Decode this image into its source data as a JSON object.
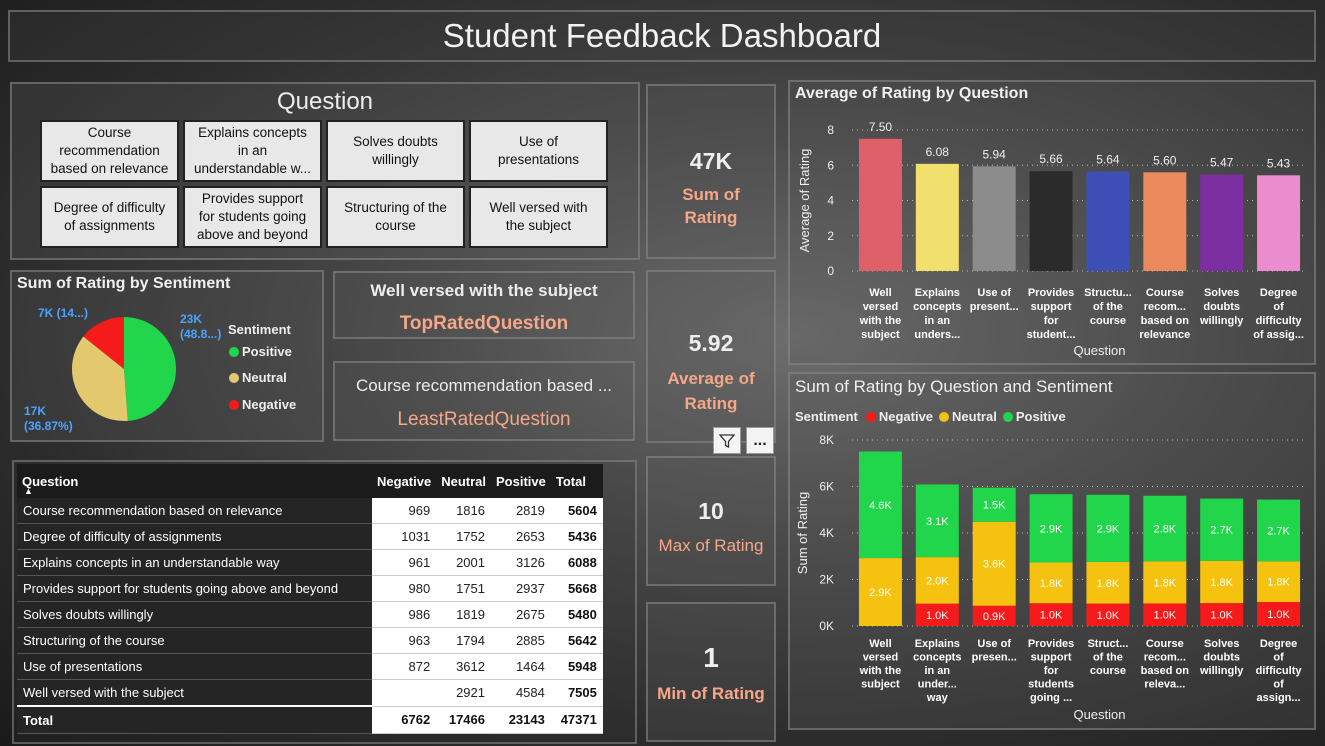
{
  "title": "Student Feedback Dashboard",
  "slicer": {
    "title": "Question",
    "items": [
      "Course recommendation based on relevance",
      "Explains concepts in an understandable w...",
      "Solves doubts willingly",
      "Use of presentations",
      "Degree of difficulty of assignments",
      "Provides support for students going above and beyond",
      "Structuring of the course",
      "Well versed with the subject"
    ]
  },
  "pie": {
    "title": "Sum of Rating by Sentiment",
    "label_positive": "23K (48.8...)",
    "label_neutral": "17K (36.87%)",
    "label_negative": "7K (14...)",
    "legend_title": "Sentiment",
    "legend": [
      "Positive",
      "Neutral",
      "Negative"
    ],
    "values": {
      "positive": 23143,
      "neutral": 17466,
      "negative": 6762
    },
    "colors": {
      "positive": "#21d64a",
      "neutral": "#e3c86d",
      "negative": "#f51b1b"
    }
  },
  "cards": {
    "top_value": "Well versed with the subject",
    "top_label": "TopRatedQuestion",
    "least_value": "Course recommendation based ...",
    "least_label": "LeastRatedQuestion",
    "sum_value": "47K",
    "sum_label_1": "Sum of",
    "sum_label_2": "Rating",
    "avg_value": "5.92",
    "avg_label_1": "Average of",
    "avg_label_2": "Rating",
    "max_value": "10",
    "max_label": "Max of Rating",
    "min_value": "1",
    "min_label": "Min of Rating"
  },
  "toolbar": {
    "filter_icon": "filter-icon",
    "more_label": "..."
  },
  "table": {
    "headers": [
      "Question",
      "Negative",
      "Neutral",
      "Positive",
      "Total"
    ],
    "rows": [
      [
        "Course recommendation based on relevance",
        "969",
        "1816",
        "2819",
        "5604"
      ],
      [
        "Degree of difficulty of assignments",
        "1031",
        "1752",
        "2653",
        "5436"
      ],
      [
        "Explains concepts in an understandable way",
        "961",
        "2001",
        "3126",
        "6088"
      ],
      [
        "Provides support for students going above and beyond",
        "980",
        "1751",
        "2937",
        "5668"
      ],
      [
        "Solves doubts willingly",
        "986",
        "1819",
        "2675",
        "5480"
      ],
      [
        "Structuring of the course",
        "963",
        "1794",
        "2885",
        "5642"
      ],
      [
        "Use of presentations",
        "872",
        "3612",
        "1464",
        "5948"
      ],
      [
        "Well versed with the subject",
        "",
        "2921",
        "4584",
        "7505"
      ]
    ],
    "total": [
      "Total",
      "6762",
      "17466",
      "23143",
      "47371"
    ]
  },
  "chart_data": [
    {
      "type": "bar",
      "title": "Average of Rating by Question",
      "xlabel": "Question",
      "ylabel": "Average of Rating",
      "ylim": [
        0,
        8
      ],
      "yticks": [
        "0",
        "2",
        "4",
        "6",
        "8"
      ],
      "categories": [
        [
          "Well",
          "versed",
          "with the",
          "subject"
        ],
        [
          "Explains",
          "concepts",
          "in an",
          "unders..."
        ],
        [
          "Use of",
          "present..."
        ],
        [
          "Provides",
          "support",
          "for",
          "student..."
        ],
        [
          "Structu...",
          "of the",
          "course"
        ],
        [
          "Course",
          "recom...",
          "based on",
          "relevance"
        ],
        [
          "Solves",
          "doubts",
          "willingly"
        ],
        [
          "Degree",
          "of",
          "difficulty",
          "of assig..."
        ]
      ],
      "values": [
        7.5,
        6.08,
        5.94,
        5.66,
        5.64,
        5.6,
        5.47,
        5.43
      ],
      "labels": [
        "7.50",
        "6.08",
        "5.94",
        "5.66",
        "5.64",
        "5.60",
        "5.47",
        "5.43"
      ],
      "colors": [
        "#e0606a",
        "#f2e06e",
        "#8c8c8c",
        "#2b2b2b",
        "#3f4fb8",
        "#eb8a5c",
        "#7b2fa0",
        "#ea8ccd"
      ],
      "grid": true
    },
    {
      "type": "bar",
      "stacked": true,
      "title": "Sum of Rating by Question and Sentiment",
      "xlabel": "Question",
      "ylabel": "Sum of Rating",
      "ylim": [
        0,
        8000
      ],
      "yticks": [
        "0K",
        "2K",
        "4K",
        "6K",
        "8K"
      ],
      "legend_title": "Sentiment",
      "legend_position": "top-left",
      "categories": [
        [
          "Well",
          "versed",
          "with the",
          "subject"
        ],
        [
          "Explains",
          "concepts",
          "in an",
          "under...",
          "way"
        ],
        [
          "Use of",
          "presen..."
        ],
        [
          "Provides",
          "support",
          "for",
          "students",
          "going ..."
        ],
        [
          "Struct...",
          "of the",
          "course"
        ],
        [
          "Course",
          "recom...",
          "based on",
          "releva..."
        ],
        [
          "Solves",
          "doubts",
          "willingly"
        ],
        [
          "Degree",
          "of",
          "difficulty",
          "of",
          "assign..."
        ]
      ],
      "series": [
        {
          "name": "Negative",
          "color": "#f51b1b",
          "values": [
            0,
            961,
            872,
            980,
            963,
            969,
            986,
            1031
          ],
          "labels": [
            "",
            "1.0K",
            "0.9K",
            "1.0K",
            "1.0K",
            "1.0K",
            "1.0K",
            "1.0K"
          ]
        },
        {
          "name": "Neutral",
          "color": "#f4c20f",
          "values": [
            2921,
            2001,
            3612,
            1751,
            1794,
            1816,
            1819,
            1752
          ],
          "labels": [
            "2.9K",
            "2.0K",
            "3.6K",
            "1.8K",
            "1.8K",
            "1.8K",
            "1.8K",
            "1.8K"
          ]
        },
        {
          "name": "Positive",
          "color": "#21d64a",
          "values": [
            4584,
            3126,
            1464,
            2937,
            2885,
            2819,
            2675,
            2653
          ],
          "labels": [
            "4.6K",
            "3.1K",
            "1.5K",
            "2.9K",
            "2.9K",
            "2.8K",
            "2.7K",
            "2.7K"
          ]
        }
      ],
      "grid": true
    }
  ]
}
